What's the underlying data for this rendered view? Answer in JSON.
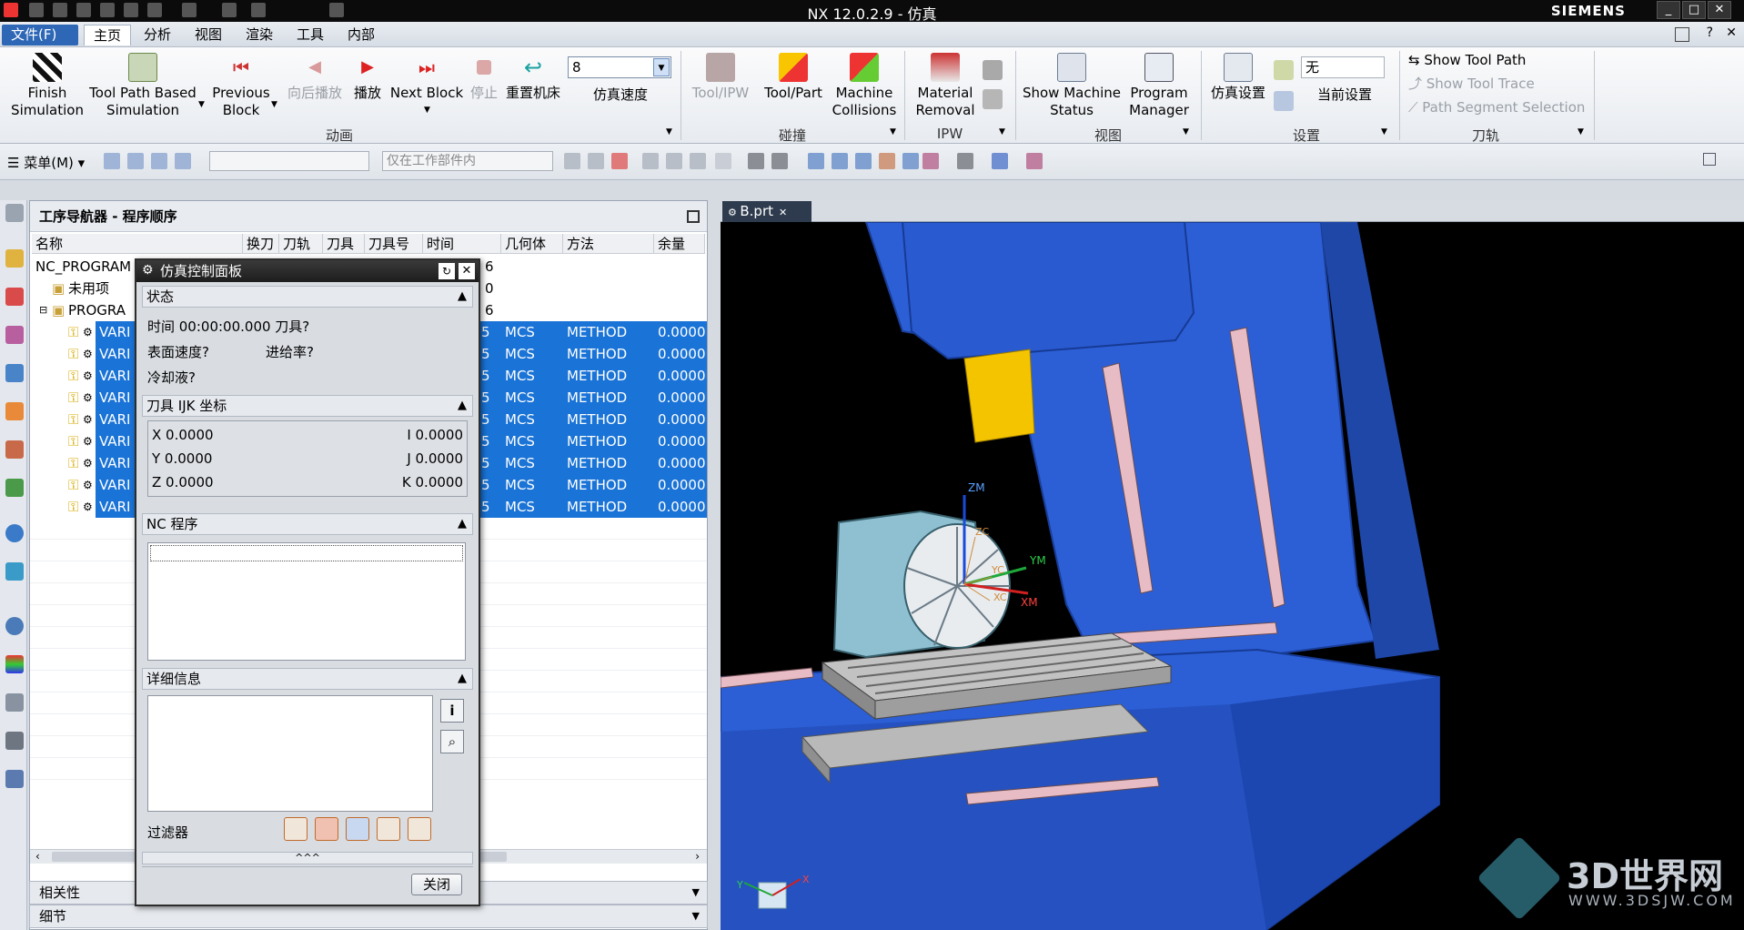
{
  "window": {
    "title": "NX 12.0.2.9 - 仿真",
    "brand": "SIEMENS",
    "min": "_",
    "max": "□",
    "close": "✕"
  },
  "menu": {
    "file": "文件(F)",
    "tabs": [
      "主页",
      "分析",
      "视图",
      "渲染",
      "工具",
      "内部"
    ]
  },
  "ribbon": {
    "finish_sim": "Finish\nSimulation",
    "toolpath_sim": "Tool Path Based\nSimulation",
    "prev_block": "Previous\nBlock",
    "reverse_play": "向后播放",
    "play": "播放",
    "next_block": "Next Block",
    "stop": "停止",
    "reset_machine": "重置机床",
    "speed_value": "8",
    "speed_label": "仿真速度",
    "group_animation": "动画",
    "tool_ipw": "Tool/IPW",
    "tool_part": "Tool/Part",
    "machine_collisions": "Machine\nCollisions",
    "group_collision": "碰撞",
    "material_removal": "Material\nRemoval",
    "group_ipw": "IPW",
    "show_machine_status": "Show Machine\nStatus",
    "program_manager": "Program\nManager",
    "group_view": "视图",
    "sim_settings": "仿真设置",
    "current_settings_value": "无",
    "current_settings": "当前设置",
    "group_settings": "设置",
    "show_tool_path": "Show Tool Path",
    "show_tool_trace": "Show Tool Trace",
    "path_segment_selection": "Path Segment Selection",
    "group_toolpath": "刀轨"
  },
  "toolbar2": {
    "menu": "菜单(M)",
    "filter_placeholder": "",
    "scope": "仅在工作部件内"
  },
  "navigator": {
    "title": "工序导航器 - 程序顺序",
    "columns": [
      "名称",
      "换刀",
      "刀轨",
      "刀具",
      "刀具号",
      "时间",
      "几何体",
      "方法",
      "余量"
    ],
    "root": "NC_PROGRAM",
    "root_time_frag": "6",
    "unused": "未用项",
    "unused_time_frag": "0",
    "program": "PROGRA",
    "program_time_frag": "6",
    "ops": [
      {
        "name": "VARI",
        "tfrag": "5",
        "geom": "MCS",
        "method": "METHOD",
        "stock": "0.0000"
      },
      {
        "name": "VARI",
        "tfrag": "5",
        "geom": "MCS",
        "method": "METHOD",
        "stock": "0.0000"
      },
      {
        "name": "VARI",
        "tfrag": "5",
        "geom": "MCS",
        "method": "METHOD",
        "stock": "0.0000"
      },
      {
        "name": "VARI",
        "tfrag": "5",
        "geom": "MCS",
        "method": "METHOD",
        "stock": "0.0000"
      },
      {
        "name": "VARI",
        "tfrag": "5",
        "geom": "MCS",
        "method": "METHOD",
        "stock": "0.0000"
      },
      {
        "name": "VARI",
        "tfrag": "5",
        "geom": "MCS",
        "method": "METHOD",
        "stock": "0.0000"
      },
      {
        "name": "VARI",
        "tfrag": "5",
        "geom": "MCS",
        "method": "METHOD",
        "stock": "0.0000"
      },
      {
        "name": "VARI",
        "tfrag": "5",
        "geom": "MCS",
        "method": "METHOD",
        "stock": "0.0000"
      },
      {
        "name": "VARI",
        "tfrag": "5",
        "geom": "MCS",
        "method": "METHOD",
        "stock": "0.0000"
      }
    ]
  },
  "sim_panel": {
    "title": "仿真控制面板",
    "status_header": "状态",
    "time_line": "时间 00:00:00.000 刀具?",
    "surface_speed": "表面速度?",
    "feed_rate": "进给率?",
    "coolant": "冷却液?",
    "ijk_header": "刀具 IJK 坐标",
    "x": "X 0.0000",
    "y": "Y 0.0000",
    "z": "Z 0.0000",
    "i": "I 0.0000",
    "j": "J 0.0000",
    "k": "K 0.0000",
    "nc_header": "NC 程序",
    "detail_header": "详细信息",
    "filter": "过滤器",
    "collapse": "^^^",
    "close_btn": "关闭"
  },
  "viewport": {
    "tab": "B.prt",
    "labels": {
      "zm": "ZM",
      "ym": "YM",
      "xm": "XM",
      "yc": "YC",
      "xc": "XC",
      "zc": "ZC",
      "tx": "X",
      "ty": "Y"
    }
  },
  "bottom": {
    "dependencies": "相关性",
    "details": "细节"
  },
  "watermark": {
    "cn": "3D世界网",
    "url": "WWW.3DSJW.COM"
  }
}
